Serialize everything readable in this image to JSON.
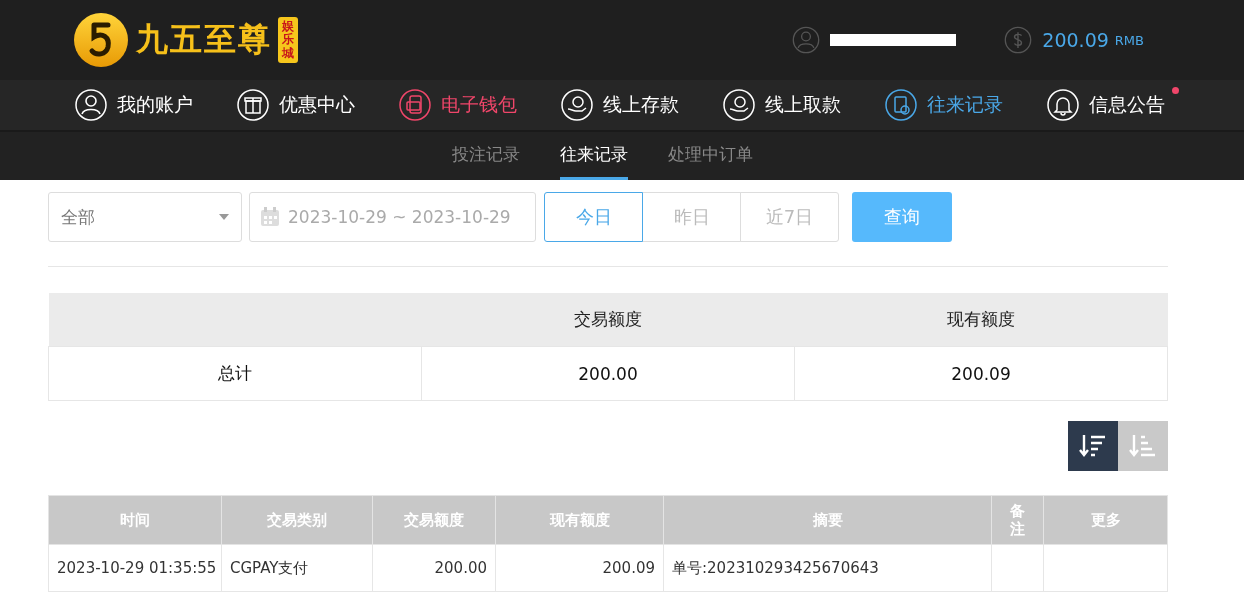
{
  "header": {
    "logo_title": "九五至尊",
    "logo_badge": "娱乐城",
    "balance": "200.09",
    "currency": "RMB"
  },
  "nav": [
    {
      "label": "我的账户",
      "kind": "user",
      "color": "#ffffff",
      "dot": false
    },
    {
      "label": "优惠中心",
      "kind": "gift",
      "color": "#ffffff",
      "dot": false
    },
    {
      "label": "电子钱包",
      "kind": "wallet",
      "color": "#f0466a",
      "dot": false
    },
    {
      "label": "线上存款",
      "kind": "deposit",
      "color": "#ffffff",
      "dot": false
    },
    {
      "label": "线上取款",
      "kind": "withdraw",
      "color": "#ffffff",
      "dot": false
    },
    {
      "label": "往来记录",
      "kind": "records",
      "color": "#4aa8e8",
      "dot": false
    },
    {
      "label": "信息公告",
      "kind": "bell",
      "color": "#ffffff",
      "dot": true
    }
  ],
  "subtabs": [
    {
      "label": "投注记录",
      "selected": false
    },
    {
      "label": "往来记录",
      "selected": true
    },
    {
      "label": "处理中订单",
      "selected": false
    }
  ],
  "filter": {
    "type_select": "全部",
    "date_range": "2023-10-29 ~ 2023-10-29",
    "quick": [
      {
        "label": "今日",
        "selected": true
      },
      {
        "label": "昨日",
        "selected": false
      },
      {
        "label": "近7日",
        "selected": false
      }
    ],
    "query_button": "查询"
  },
  "summary": {
    "columns": [
      "",
      "交易额度",
      "现有额度"
    ],
    "row": [
      "总计",
      "200.00",
      "200.09"
    ]
  },
  "sort_buttons": [
    {
      "kind": "desc",
      "selected": true
    },
    {
      "kind": "asc",
      "selected": false
    }
  ],
  "records": {
    "columns": [
      "时间",
      "交易类别",
      "交易额度",
      "现有额度",
      "摘要",
      "备注",
      "更多"
    ],
    "rows": [
      [
        "2023-10-29 01:35:55",
        "CGPAY支付",
        "200.00",
        "200.09",
        "单号:202310293425670643",
        "",
        ""
      ]
    ]
  }
}
